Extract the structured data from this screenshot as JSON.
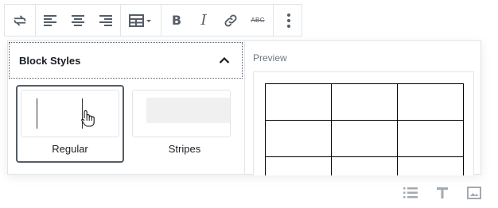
{
  "toolbar": {
    "transform_icon": "block-switcher-icon",
    "align_left_icon": "align-left-icon",
    "align_center_icon": "align-center-icon",
    "align_right_icon": "align-right-icon",
    "table_icon": "table-edit-icon",
    "bold_label": "B",
    "italic_label": "I",
    "link_icon": "link-icon",
    "strikethrough_label": "ABC",
    "more_icon": "more-options-icon"
  },
  "styles_panel": {
    "title": "Block Styles",
    "expanded": true,
    "styles": [
      {
        "label": "Regular",
        "selected": true
      },
      {
        "label": "Stripes",
        "selected": false
      }
    ],
    "preview_label": "Preview",
    "preview_table": {
      "rows": 3,
      "cols": 3
    }
  },
  "inserter": {
    "icons": [
      "list-icon",
      "heading-icon",
      "image-icon"
    ]
  },
  "colors": {
    "border": "#e2e4e7",
    "icon": "#555d66",
    "muted_icon": "#a2aab2"
  }
}
